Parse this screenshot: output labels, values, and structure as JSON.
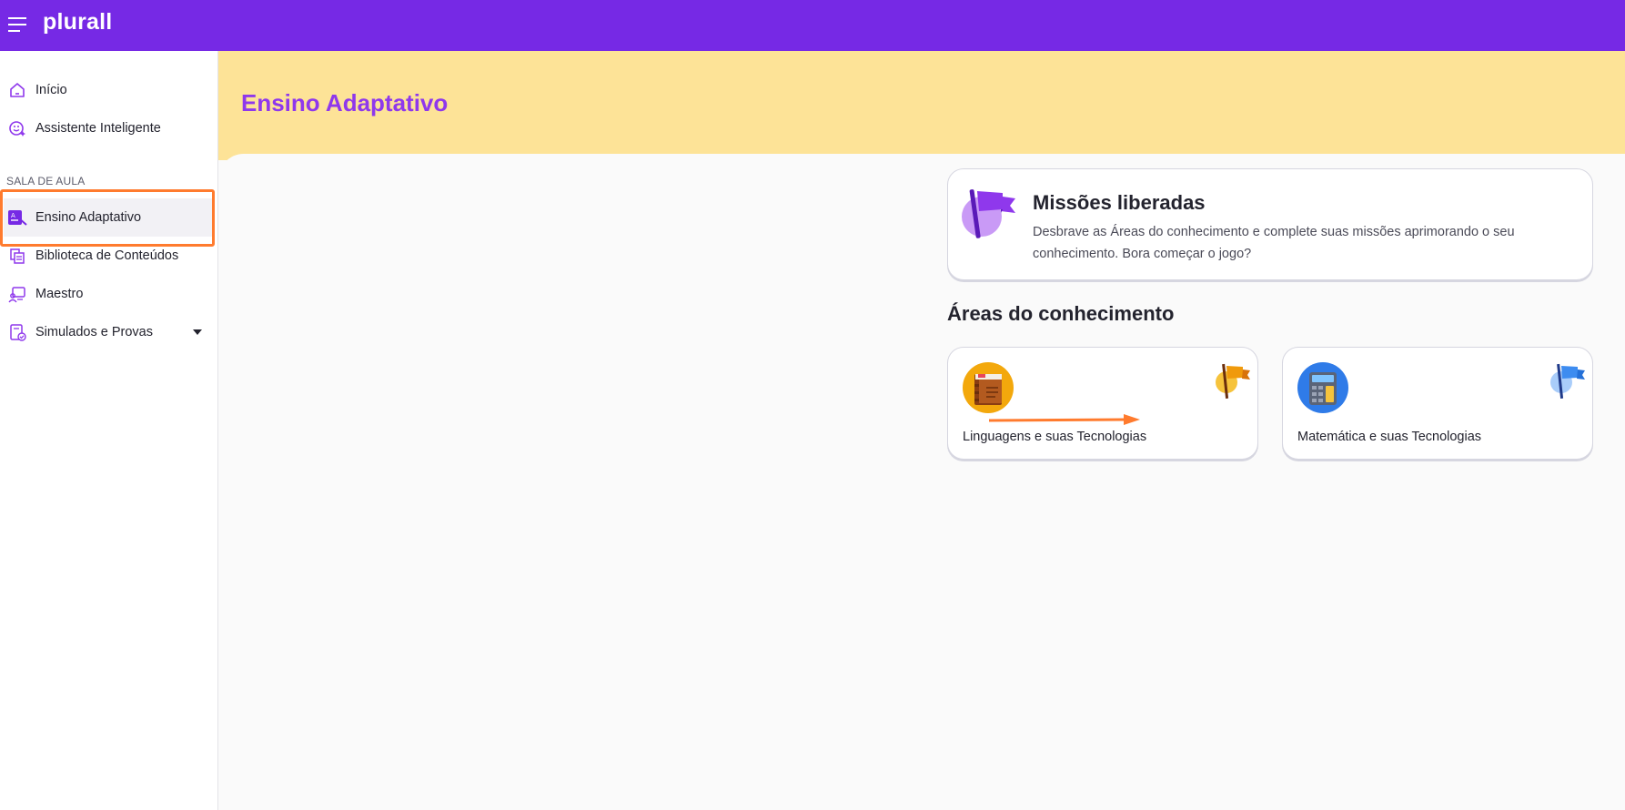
{
  "app": {
    "logo_text": "plurall",
    "brand_color": "#7629e5"
  },
  "sidebar": {
    "items_top": [
      {
        "label": "Início",
        "icon": "home-icon"
      },
      {
        "label": "Assistente Inteligente",
        "icon": "smart-assistant-icon"
      }
    ],
    "section_title": "SALA DE AULA",
    "items_section": [
      {
        "label": "Ensino Adaptativo",
        "icon": "adaptive-learning-icon",
        "active": true
      },
      {
        "label": "Biblioteca de Conteúdos",
        "icon": "library-icon"
      },
      {
        "label": "Maestro",
        "icon": "maestro-icon"
      },
      {
        "label": "Simulados e Provas",
        "icon": "exams-icon",
        "has_dropdown": true
      }
    ]
  },
  "main": {
    "page_title": "Ensino Adaptativo",
    "hero_color": "#fde397",
    "missions": {
      "title": "Missões liberadas",
      "description": "Desbrave as Áreas do conhecimento e complete suas missões aprimorando o seu conhecimento. Bora começar o jogo?"
    },
    "areas_title": "Áreas do conhecimento",
    "areas": [
      {
        "label": "Linguagens e suas Tecnologias",
        "icon": "book-icon",
        "flag": "orange-flag-icon"
      },
      {
        "label": "Matemática e suas Tecnologias",
        "icon": "calculator-icon",
        "flag": "blue-flag-icon"
      }
    ]
  },
  "annotations": {
    "highlight_color": "#ff7b2e"
  }
}
